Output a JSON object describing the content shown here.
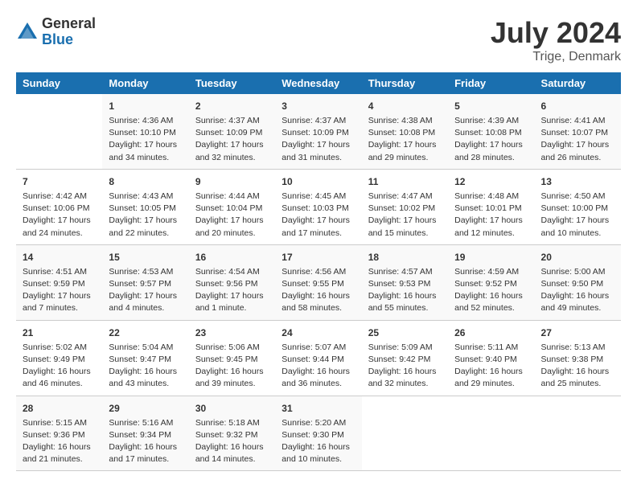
{
  "header": {
    "logo_general": "General",
    "logo_blue": "Blue",
    "month_title": "July 2024",
    "location": "Trige, Denmark"
  },
  "calendar": {
    "columns": [
      "Sunday",
      "Monday",
      "Tuesday",
      "Wednesday",
      "Thursday",
      "Friday",
      "Saturday"
    ],
    "rows": [
      [
        {
          "day": "",
          "info": ""
        },
        {
          "day": "1",
          "info": "Sunrise: 4:36 AM\nSunset: 10:10 PM\nDaylight: 17 hours\nand 34 minutes."
        },
        {
          "day": "2",
          "info": "Sunrise: 4:37 AM\nSunset: 10:09 PM\nDaylight: 17 hours\nand 32 minutes."
        },
        {
          "day": "3",
          "info": "Sunrise: 4:37 AM\nSunset: 10:09 PM\nDaylight: 17 hours\nand 31 minutes."
        },
        {
          "day": "4",
          "info": "Sunrise: 4:38 AM\nSunset: 10:08 PM\nDaylight: 17 hours\nand 29 minutes."
        },
        {
          "day": "5",
          "info": "Sunrise: 4:39 AM\nSunset: 10:08 PM\nDaylight: 17 hours\nand 28 minutes."
        },
        {
          "day": "6",
          "info": "Sunrise: 4:41 AM\nSunset: 10:07 PM\nDaylight: 17 hours\nand 26 minutes."
        }
      ],
      [
        {
          "day": "7",
          "info": "Sunrise: 4:42 AM\nSunset: 10:06 PM\nDaylight: 17 hours\nand 24 minutes."
        },
        {
          "day": "8",
          "info": "Sunrise: 4:43 AM\nSunset: 10:05 PM\nDaylight: 17 hours\nand 22 minutes."
        },
        {
          "day": "9",
          "info": "Sunrise: 4:44 AM\nSunset: 10:04 PM\nDaylight: 17 hours\nand 20 minutes."
        },
        {
          "day": "10",
          "info": "Sunrise: 4:45 AM\nSunset: 10:03 PM\nDaylight: 17 hours\nand 17 minutes."
        },
        {
          "day": "11",
          "info": "Sunrise: 4:47 AM\nSunset: 10:02 PM\nDaylight: 17 hours\nand 15 minutes."
        },
        {
          "day": "12",
          "info": "Sunrise: 4:48 AM\nSunset: 10:01 PM\nDaylight: 17 hours\nand 12 minutes."
        },
        {
          "day": "13",
          "info": "Sunrise: 4:50 AM\nSunset: 10:00 PM\nDaylight: 17 hours\nand 10 minutes."
        }
      ],
      [
        {
          "day": "14",
          "info": "Sunrise: 4:51 AM\nSunset: 9:59 PM\nDaylight: 17 hours\nand 7 minutes."
        },
        {
          "day": "15",
          "info": "Sunrise: 4:53 AM\nSunset: 9:57 PM\nDaylight: 17 hours\nand 4 minutes."
        },
        {
          "day": "16",
          "info": "Sunrise: 4:54 AM\nSunset: 9:56 PM\nDaylight: 17 hours\nand 1 minute."
        },
        {
          "day": "17",
          "info": "Sunrise: 4:56 AM\nSunset: 9:55 PM\nDaylight: 16 hours\nand 58 minutes."
        },
        {
          "day": "18",
          "info": "Sunrise: 4:57 AM\nSunset: 9:53 PM\nDaylight: 16 hours\nand 55 minutes."
        },
        {
          "day": "19",
          "info": "Sunrise: 4:59 AM\nSunset: 9:52 PM\nDaylight: 16 hours\nand 52 minutes."
        },
        {
          "day": "20",
          "info": "Sunrise: 5:00 AM\nSunset: 9:50 PM\nDaylight: 16 hours\nand 49 minutes."
        }
      ],
      [
        {
          "day": "21",
          "info": "Sunrise: 5:02 AM\nSunset: 9:49 PM\nDaylight: 16 hours\nand 46 minutes."
        },
        {
          "day": "22",
          "info": "Sunrise: 5:04 AM\nSunset: 9:47 PM\nDaylight: 16 hours\nand 43 minutes."
        },
        {
          "day": "23",
          "info": "Sunrise: 5:06 AM\nSunset: 9:45 PM\nDaylight: 16 hours\nand 39 minutes."
        },
        {
          "day": "24",
          "info": "Sunrise: 5:07 AM\nSunset: 9:44 PM\nDaylight: 16 hours\nand 36 minutes."
        },
        {
          "day": "25",
          "info": "Sunrise: 5:09 AM\nSunset: 9:42 PM\nDaylight: 16 hours\nand 32 minutes."
        },
        {
          "day": "26",
          "info": "Sunrise: 5:11 AM\nSunset: 9:40 PM\nDaylight: 16 hours\nand 29 minutes."
        },
        {
          "day": "27",
          "info": "Sunrise: 5:13 AM\nSunset: 9:38 PM\nDaylight: 16 hours\nand 25 minutes."
        }
      ],
      [
        {
          "day": "28",
          "info": "Sunrise: 5:15 AM\nSunset: 9:36 PM\nDaylight: 16 hours\nand 21 minutes."
        },
        {
          "day": "29",
          "info": "Sunrise: 5:16 AM\nSunset: 9:34 PM\nDaylight: 16 hours\nand 17 minutes."
        },
        {
          "day": "30",
          "info": "Sunrise: 5:18 AM\nSunset: 9:32 PM\nDaylight: 16 hours\nand 14 minutes."
        },
        {
          "day": "31",
          "info": "Sunrise: 5:20 AM\nSunset: 9:30 PM\nDaylight: 16 hours\nand 10 minutes."
        },
        {
          "day": "",
          "info": ""
        },
        {
          "day": "",
          "info": ""
        },
        {
          "day": "",
          "info": ""
        }
      ]
    ]
  }
}
